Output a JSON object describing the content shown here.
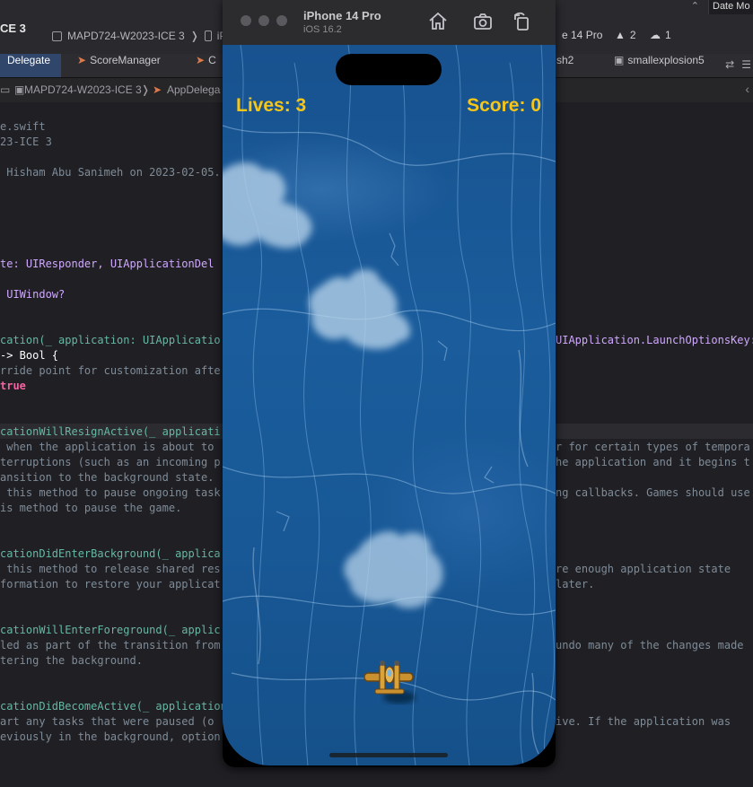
{
  "xcode": {
    "title_fragment": "CE 3",
    "scheme_left": "MAPD724-W2023-ICE 3",
    "scheme_left_tail": "iP",
    "scheme_right_tail": "e 14 Pro",
    "warnings": "2",
    "cloud_count": "1",
    "date_mode": "Date Mo",
    "tabs": [
      {
        "label": "Delegate"
      },
      {
        "label": "ScoreManager"
      },
      {
        "label": "C"
      },
      {
        "label": "sh2"
      },
      {
        "label": "smallexplosion5"
      }
    ],
    "jumpbar": {
      "project": "MAPD724-W2023-ICE 3",
      "file": "AppDelega"
    },
    "code_lines": [
      {
        "id": "l1",
        "text": "e.swift"
      },
      {
        "id": "l2",
        "text": "23-ICE 3"
      },
      {
        "id": "l3",
        "text": " Hisham Abu Sanimeh on 2023-02-05."
      },
      {
        "id": "l4",
        "text": "te: UIResponder, UIApplicationDel"
      },
      {
        "id": "l5",
        "text": " UIWindow?"
      },
      {
        "id": "l6",
        "text": "cation(_ application: UIApplicatio"
      },
      {
        "id": "l6b",
        "text": "UIApplication.LaunchOptionsKey:"
      },
      {
        "id": "l7",
        "text": "-> Bool {"
      },
      {
        "id": "l8",
        "text": "rride point for customization afte"
      },
      {
        "id": "l9",
        "text": "true"
      },
      {
        "id": "l10",
        "text": "cationWillResignActive(_ applicati"
      },
      {
        "id": "l11",
        "text": " when the application is about to"
      },
      {
        "id": "l11b",
        "text": "r for certain types of tempora"
      },
      {
        "id": "l12",
        "text": "terruptions (such as an incoming p"
      },
      {
        "id": "l12b",
        "text": "he application and it begins t"
      },
      {
        "id": "l13",
        "text": "ansition to the background state."
      },
      {
        "id": "l14",
        "text": " this method to pause ongoing task"
      },
      {
        "id": "l14b",
        "text": "ng callbacks. Games should use"
      },
      {
        "id": "l15",
        "text": "is method to pause the game."
      },
      {
        "id": "l16",
        "text": "cationDidEnterBackground(_ applica"
      },
      {
        "id": "l17",
        "text": " this method to release shared res"
      },
      {
        "id": "l17b",
        "text": "re enough application state"
      },
      {
        "id": "l18",
        "text": "formation to restore your applicat"
      },
      {
        "id": "l18b",
        "text": "later."
      },
      {
        "id": "l19",
        "text": "cationWillEnterForeground(_ applic"
      },
      {
        "id": "l20",
        "text": "led as part of the transition from"
      },
      {
        "id": "l20b",
        "text": "undo many of the changes made"
      },
      {
        "id": "l21",
        "text": "tering the background."
      },
      {
        "id": "l22",
        "text": "cationDidBecomeActive(_ application"
      },
      {
        "id": "l23",
        "text": "art any tasks that were paused (o"
      },
      {
        "id": "l23b",
        "text": "ive. If the application was"
      },
      {
        "id": "l24",
        "text": "eviously in the background, option"
      }
    ]
  },
  "simulator": {
    "device_name": "iPhone 14 Pro",
    "os_version": "iOS 16.2",
    "toolbar_icons": [
      "home-icon",
      "screenshot-icon",
      "rotate-icon"
    ],
    "game": {
      "lives_text": "Lives: 3",
      "score_text": "Score: 0",
      "clouds": 3,
      "player": "plane-sprite"
    }
  },
  "colors": {
    "hud_text": "#f5c518",
    "ocean": "#1a5c9c",
    "active_tab": "#30466b"
  }
}
